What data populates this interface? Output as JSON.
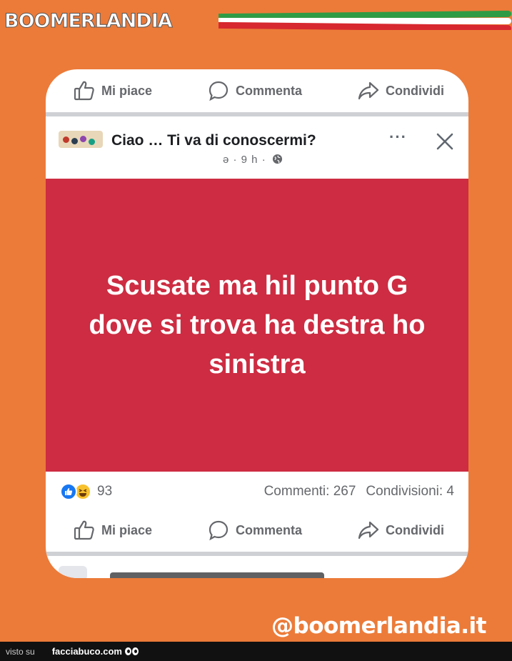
{
  "brand": {
    "name": "BOOMERLANDIA"
  },
  "post": {
    "top_actions": {
      "like": "Mi piace",
      "comment": "Commenta",
      "share": "Condividi"
    },
    "title": "Ciao … Ti va di conoscermi?",
    "meta": "ə · 9 h ·",
    "more_label": "···",
    "image_text": "Scusate ma hil punto G dove si trova ha destra ho sinistra",
    "reactions_count": "93",
    "comments": "Commenti: 267",
    "shares": "Condivisioni: 4",
    "bottom_actions": {
      "like": "Mi piace",
      "comment": "Commenta",
      "share": "Condividi"
    }
  },
  "watermark": {
    "handle": "@boomerlandia.it"
  },
  "footer": {
    "visto": "visto su",
    "site": "facciabuco.com"
  },
  "colors": {
    "background": "#ec7b39",
    "banner": "#cd2c42",
    "like_blue": "#1877f2"
  }
}
